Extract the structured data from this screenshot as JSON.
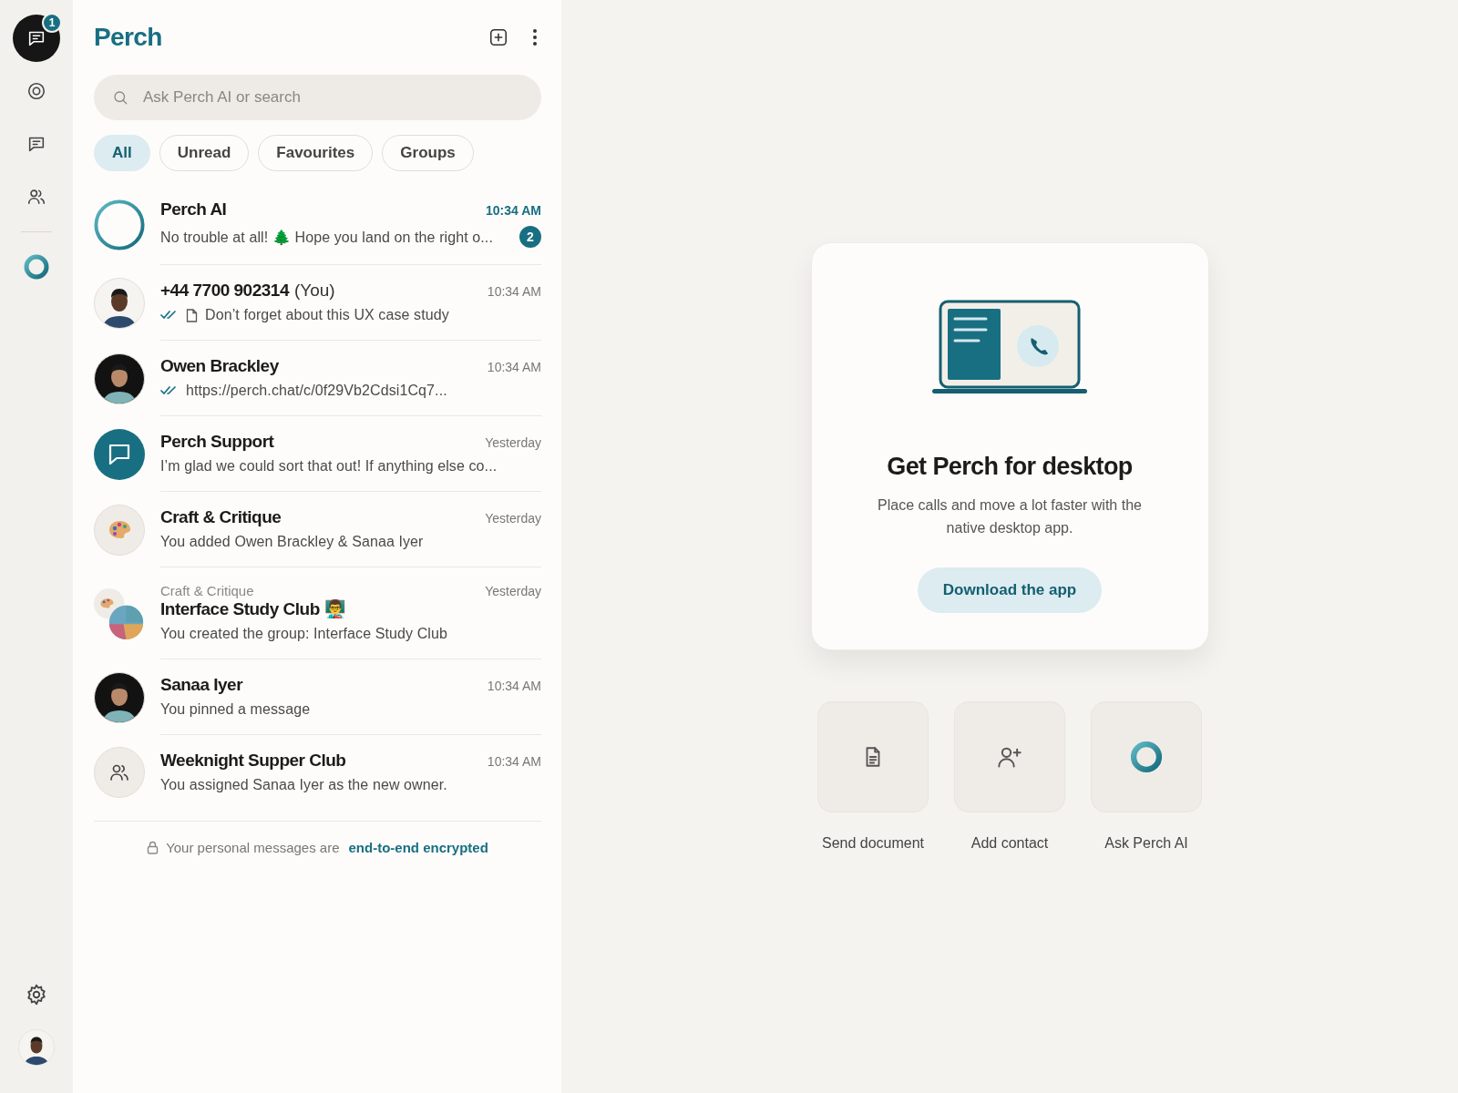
{
  "rail": {
    "items": [
      {
        "kind": "chats",
        "selected": true,
        "badge": "1"
      },
      {
        "kind": "status",
        "selected": false
      },
      {
        "kind": "channels",
        "selected": false
      },
      {
        "kind": "communities",
        "selected": false
      },
      {
        "kind": "divider"
      },
      {
        "kind": "ai",
        "selected": false
      }
    ],
    "bottom": [
      {
        "kind": "settings"
      },
      {
        "kind": "profile"
      }
    ]
  },
  "list": {
    "title": "Perch",
    "search": {
      "placeholder": "Ask Perch AI or search"
    },
    "filters": [
      {
        "label": "All",
        "selected": true
      },
      {
        "label": "Unread",
        "selected": false
      },
      {
        "label": "Favourites",
        "selected": false
      },
      {
        "label": "Groups",
        "selected": false
      }
    ],
    "chats": [
      {
        "kind": "ai",
        "name": "Perch AI",
        "time": "10:34 AM",
        "unread": true,
        "count": "2",
        "preview": "No trouble at all! 🌲 Hope you land on the right o..."
      },
      {
        "kind": "person",
        "name": "+44 7700 902314",
        "name_note": "(You)",
        "time": "10:34 AM",
        "unread": false,
        "read_receipt": true,
        "attachment": true,
        "preview": "Don’t forget about this UX case study"
      },
      {
        "kind": "person-dark",
        "name": "Owen Brackley",
        "time": "10:34 AM",
        "unread": false,
        "read_receipt": true,
        "preview": "https://perch.chat/c/0f29Vb2Cdsi1Cq7..."
      },
      {
        "kind": "support",
        "name": "Perch Support",
        "time": "Yesterday",
        "unread": false,
        "preview": "I’m glad we could sort that out! If anything else co..."
      },
      {
        "kind": "palette",
        "name": "Craft & Critique",
        "time": "Yesterday",
        "unread": false,
        "preview": "You added Owen Brackley & Sanaa Iyer"
      },
      {
        "kind": "subgroup",
        "community": "Craft & Critique",
        "name": "Interface Study Club 👨‍🏫",
        "time": "Yesterday",
        "unread": false,
        "preview": "You created the group: Interface Study Club"
      },
      {
        "kind": "person-dark",
        "name": "Sanaa Iyer",
        "time": "10:34 AM",
        "unread": false,
        "preview": "You pinned a message"
      },
      {
        "kind": "group",
        "name": "Weeknight Supper Club",
        "time": "10:34 AM",
        "unread": false,
        "preview": "You assigned Sanaa Iyer as the new owner."
      }
    ],
    "footer": {
      "text": "Your personal messages are",
      "link": "end-to-end encrypted"
    }
  },
  "promo": {
    "title": "Get Perch for desktop",
    "description": "Place calls and move a lot faster with the native desktop app.",
    "button": "Download the app",
    "actions": [
      {
        "kind": "document",
        "label": "Send document"
      },
      {
        "kind": "add-contact",
        "label": "Add contact"
      },
      {
        "kind": "ai",
        "label": "Ask Perch AI"
      }
    ]
  }
}
